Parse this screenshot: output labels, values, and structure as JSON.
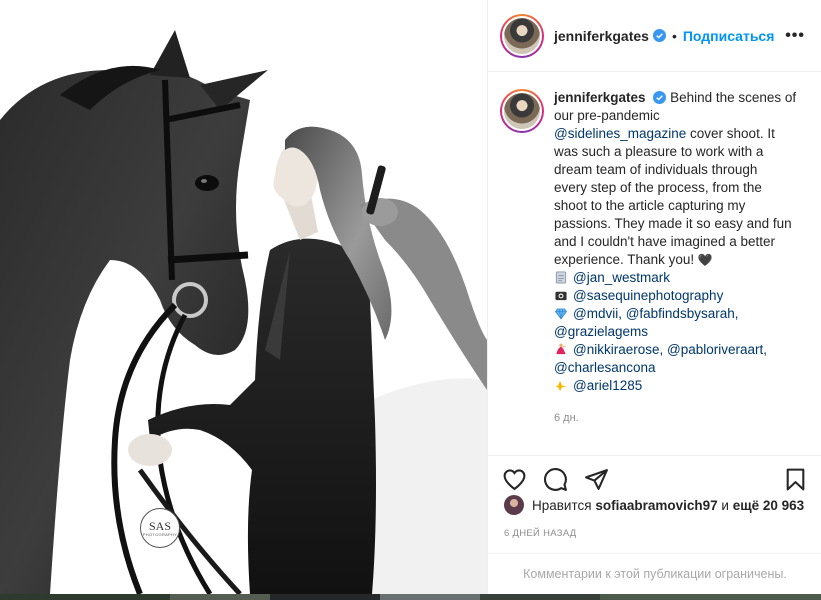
{
  "post": {
    "username": "jenniferkgates",
    "follow_label": "Подписаться",
    "more_label": "•••",
    "separator": "•"
  },
  "caption": {
    "username": "jenniferkgates",
    "line1": "Behind the scenes of",
    "line2": "our pre-pandemic",
    "mention_sidelines": "@sidelines_magazine",
    "line3_rest": " cover shoot. It",
    "line4": "was such a pleasure to work with a",
    "line5": "dream team of individuals through",
    "line6": "every step of the process, from the",
    "line7": "shoot to the article capturing my",
    "line8": "passions. They made it so easy and fun",
    "line9": "and I couldn't have imagined a better",
    "line10": "experience. Thank you! ",
    "heart": "🖤",
    "credits": [
      {
        "icon": "page-icon",
        "text": "@jan_westmark"
      },
      {
        "icon": "camera-icon",
        "text": "@sasequinephotography"
      },
      {
        "icon": "gem-icon",
        "text": "@mdvii, @fabfindsbysarah,"
      },
      {
        "icon": "",
        "text": "@grazielagems"
      },
      {
        "icon": "dancer-icon",
        "text": "@nikkiraerose, @pabloriveraart,"
      },
      {
        "icon": "",
        "text": "@charlesancona"
      },
      {
        "icon": "sparkle-icon",
        "text": "@ariel1285"
      }
    ],
    "time": "6 дн."
  },
  "likes": {
    "prefix": "Нравится ",
    "user": "sofiaabramovich97",
    "middle": " и ",
    "rest": "ещё 20 963"
  },
  "ago": "6 ДНЕЙ НАЗАД",
  "comments_limited": "Комментарии к этой публикации ограничены.",
  "watermark": "SAS",
  "watermark_sub": "PHOTOGRAPHY",
  "colors": {
    "link": "#00376b",
    "follow": "#0095f6",
    "muted": "#8e8e8e"
  }
}
